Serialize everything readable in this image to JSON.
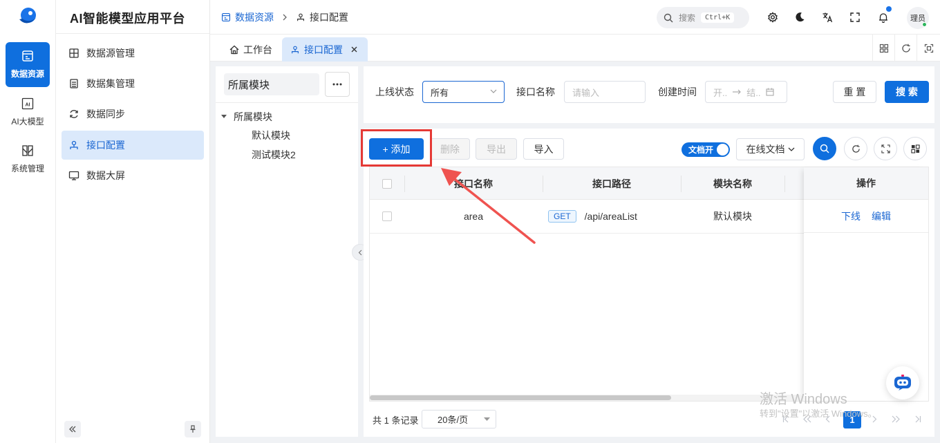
{
  "app": {
    "title": "AI智能模型应用平台"
  },
  "rail": {
    "items": [
      {
        "label": "数据资源",
        "icon": "data-resource-icon"
      },
      {
        "label": "AI大模型",
        "icon": "ai-model-icon"
      },
      {
        "label": "系统管理",
        "icon": "system-manage-icon"
      }
    ]
  },
  "sidebar": {
    "items": [
      {
        "label": "数据源管理",
        "icon": "datasource-icon"
      },
      {
        "label": "数据集管理",
        "icon": "dataset-icon"
      },
      {
        "label": "数据同步",
        "icon": "sync-icon"
      },
      {
        "label": "接口配置",
        "icon": "api-config-icon"
      },
      {
        "label": "数据大屏",
        "icon": "monitor-icon"
      }
    ]
  },
  "header": {
    "breadcrumb": [
      "数据资源",
      "接口配置"
    ],
    "search_placeholder": "搜索",
    "search_shortcut": "Ctrl+K",
    "user_label": "理员"
  },
  "tabs": [
    {
      "label": "工作台"
    },
    {
      "label": "接口配置"
    }
  ],
  "tree": {
    "module_field": "所属模块",
    "root": "所属模块",
    "children": [
      "默认模块",
      "测试模块2"
    ]
  },
  "filter": {
    "status_label": "上线状态",
    "status_value": "所有",
    "name_label": "接口名称",
    "name_placeholder": "请输入",
    "time_label": "创建时间",
    "time_start_placeholder": "开..",
    "time_end_placeholder": "结..",
    "reset_label": "重 置",
    "search_label": "搜 索"
  },
  "toolbar": {
    "add_label": "+ 添加",
    "delete_label": "删除",
    "export_label": "导出",
    "import_label": "导入",
    "doc_toggle_label": "文档开",
    "online_doc_label": "在线文档"
  },
  "table": {
    "columns": [
      "接口名称",
      "接口路径",
      "模块名称",
      "操作"
    ],
    "rows": [
      {
        "name": "area",
        "method": "GET",
        "path": "/api/areaList",
        "module": "默认模块",
        "actions": [
          "下线",
          "编辑"
        ]
      }
    ]
  },
  "pagination": {
    "total_text": "共 1 条记录",
    "page_size": "20条/页",
    "current_page": "1"
  },
  "watermark": {
    "line1": "激活 Windows",
    "line2": "转到\"设置\"以激活 Windows。"
  },
  "colors": {
    "primary": "#0f6fde",
    "highlight_box": "#e53935",
    "arrow": "#ef5350"
  }
}
